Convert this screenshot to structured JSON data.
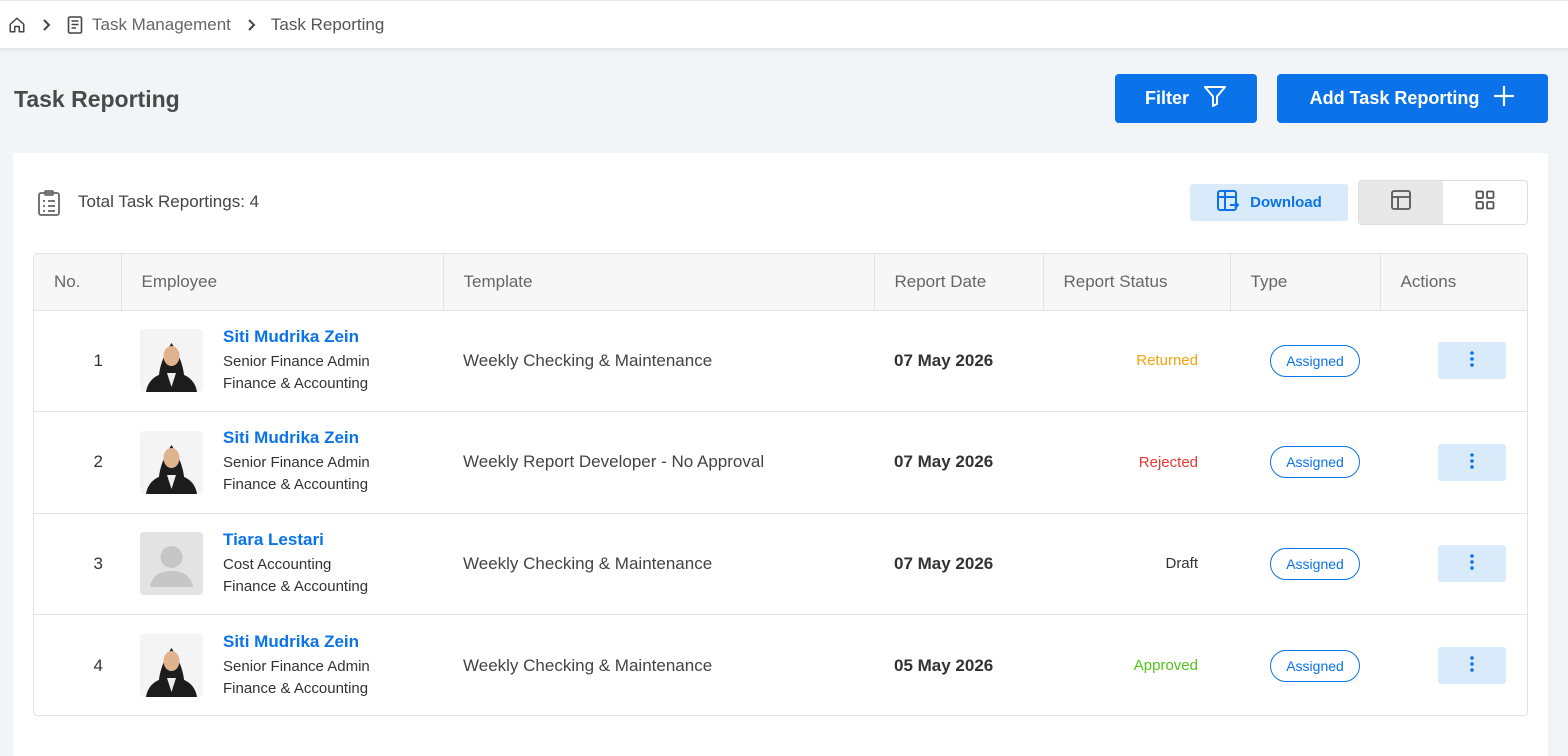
{
  "breadcrumb": {
    "icons": [
      "home-icon",
      "document-icon"
    ],
    "items": [
      "Task Management",
      "Task Reporting"
    ]
  },
  "header": {
    "title": "Task Reporting",
    "filter_label": "Filter",
    "add_label": "Add Task Reporting"
  },
  "toolbar": {
    "total_label": "Total Task Reportings: 4",
    "download_label": "Download",
    "view_modes": [
      "table-view-icon",
      "grid-view-icon"
    ],
    "active_view": "table"
  },
  "table": {
    "columns": [
      "No.",
      "Employee",
      "Template",
      "Report Date",
      "Report Status",
      "Type",
      "Actions"
    ],
    "rows": [
      {
        "no": "1",
        "name": "Siti Mudrika Zein",
        "position": "Senior Finance Admin",
        "department": "Finance & Accounting",
        "template": "Weekly Checking & Maintenance",
        "date": "07 May 2026",
        "status": "Returned",
        "type": "Assigned"
      },
      {
        "no": "2",
        "name": "Siti Mudrika Zein",
        "position": "Senior Finance Admin",
        "department": "Finance & Accounting",
        "template": "Weekly Report Developer - No Approval",
        "date": "07 May 2026",
        "status": "Rejected",
        "type": "Assigned"
      },
      {
        "no": "3",
        "name": "Tiara Lestari",
        "position": "Cost Accounting",
        "department": "Finance & Accounting",
        "template": "Weekly Checking & Maintenance",
        "date": "07 May 2026",
        "status": "Draft",
        "type": "Assigned"
      },
      {
        "no": "4",
        "name": "Siti Mudrika Zein",
        "position": "Senior Finance Admin",
        "department": "Finance & Accounting",
        "template": "Weekly Checking & Maintenance",
        "date": "05 May 2026",
        "status": "Approved",
        "type": "Assigned"
      }
    ]
  },
  "colors": {
    "primary": "#0a73e9",
    "returned": "#f5a30a",
    "rejected": "#e53935",
    "draft": "#333333",
    "approved": "#52c41a"
  }
}
